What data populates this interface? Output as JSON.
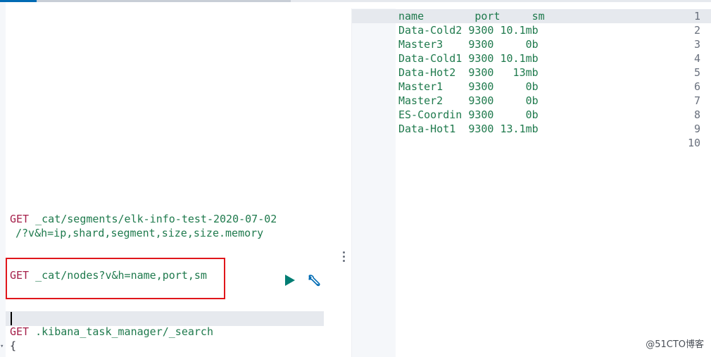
{
  "request_editor": {
    "segments_request": {
      "method": "GET",
      "path": "_cat/segments/elk-info-test-2020-07-02",
      "continuation": "/?v&h=ip,shard,segment,size,size.memory"
    },
    "nodes_request": {
      "method": "GET",
      "path": "_cat/nodes?v&h=name,port,sm"
    },
    "task_manager_request": {
      "method": "GET",
      "path": ".kibana_task_manager/_search",
      "body_open": "{"
    },
    "run_icon": "play-icon",
    "settings_icon": "wrench-icon",
    "colors": {
      "method": "#a5204a",
      "path": "#1f7a4d",
      "highlight_border": "#e0161b"
    }
  },
  "response_output": {
    "line_numbers": [
      "1",
      "2",
      "3",
      "4",
      "5",
      "6",
      "7",
      "8",
      "9",
      "10"
    ],
    "lines": [
      "name        port     sm",
      "Data-Cold2 9300 10.1mb",
      "Master3    9300     0b",
      "Data-Cold1 9300 10.1mb",
      "Data-Hot2  9300   13mb",
      "Master1    9300     0b",
      "Master2    9300     0b",
      "ES-Coordin 9300     0b",
      "Data-Hot1  9300 13.1mb",
      ""
    ]
  },
  "watermark": "@51CTO博客"
}
